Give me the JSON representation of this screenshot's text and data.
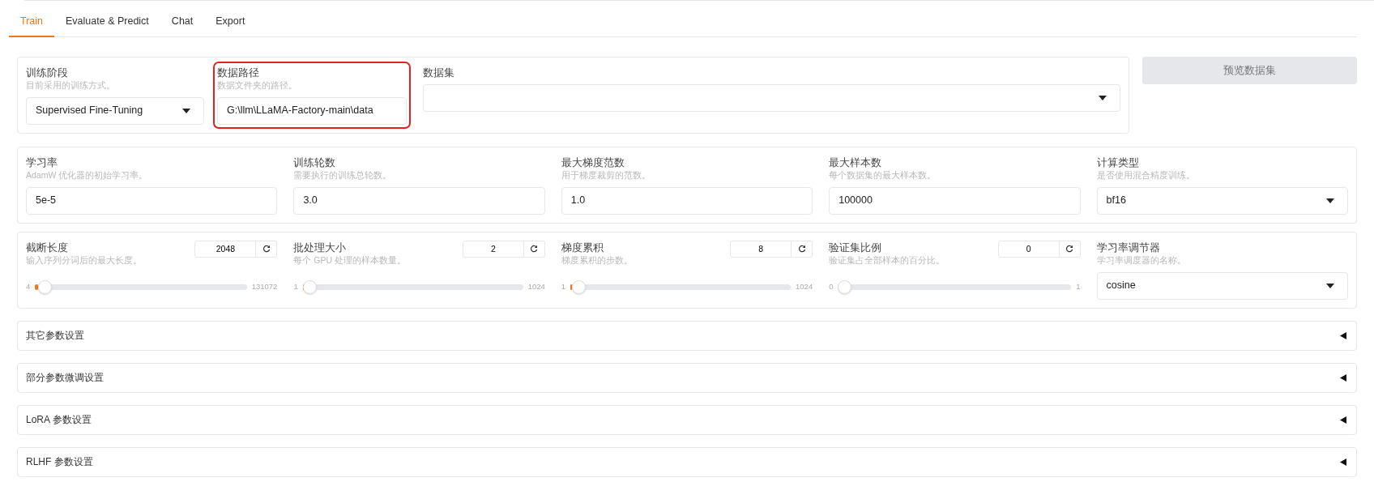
{
  "tabs": [
    {
      "label": "Train",
      "selected": true
    },
    {
      "label": "Evaluate & Predict",
      "selected": false
    },
    {
      "label": "Chat",
      "selected": false
    },
    {
      "label": "Export",
      "selected": false
    }
  ],
  "data_row": {
    "fields": [
      {
        "kind": "dropdown",
        "label": "训练阶段",
        "info": "目前采用的训练方式。",
        "value": "Supervised Fine-Tuning"
      },
      {
        "kind": "text",
        "label": "数据路径",
        "info": "数据文件夹的路径。",
        "value": "G:\\llm\\LLaMA-Factory-main\\data",
        "highlighted": true
      },
      {
        "kind": "dropdown",
        "label": "数据集"
      }
    ],
    "preview_button": {
      "label": "预览数据集",
      "disabled": true
    }
  },
  "hyperparams": [
    {
      "kind": "text",
      "label": "学习率",
      "info": "AdamW 优化器的初始学习率。",
      "value": "5e-5"
    },
    {
      "kind": "text",
      "label": "训练轮数",
      "info": "需要执行的训练总轮数。",
      "value": "3.0"
    },
    {
      "kind": "text",
      "label": "最大梯度范数",
      "info": "用于梯度裁剪的范数。",
      "value": "1.0"
    },
    {
      "kind": "text",
      "label": "最大样本数",
      "info": "每个数据集的最大样本数。",
      "value": "100000"
    },
    {
      "kind": "dropdown",
      "label": "计算类型",
      "info": "是否使用混合精度训练。",
      "value": "bf16"
    }
  ],
  "slider_row": [
    {
      "kind": "slider",
      "label": "截断长度",
      "info": "输入序列分词后的最大长度。",
      "value": "2048",
      "min": "4",
      "max": "131072",
      "level": 0.0156
    },
    {
      "kind": "slider",
      "label": "批处理大小",
      "info": "每个 GPU 处理的样本数量。",
      "value": "2",
      "min": "1",
      "max": "1024",
      "level": 0.001
    },
    {
      "kind": "slider",
      "label": "梯度累积",
      "info": "梯度累积的步数。",
      "value": "8",
      "min": "1",
      "max": "1024",
      "level": 0.0068
    },
    {
      "kind": "slider",
      "label": "验证集比例",
      "info": "验证集占全部样本的百分比。",
      "value": "0",
      "min": "0",
      "max": "1",
      "level": 0
    },
    {
      "kind": "dropdown",
      "label": "学习率调节器",
      "info": "学习率调度器的名称。",
      "value": "cosine"
    }
  ],
  "accordions": [
    {
      "label": "其它参数设置",
      "expanded": false
    },
    {
      "label": "部分参数微调设置",
      "expanded": false
    },
    {
      "label": "LoRA 参数设置",
      "expanded": false
    },
    {
      "label": "RLHF 参数设置",
      "expanded": false
    }
  ]
}
